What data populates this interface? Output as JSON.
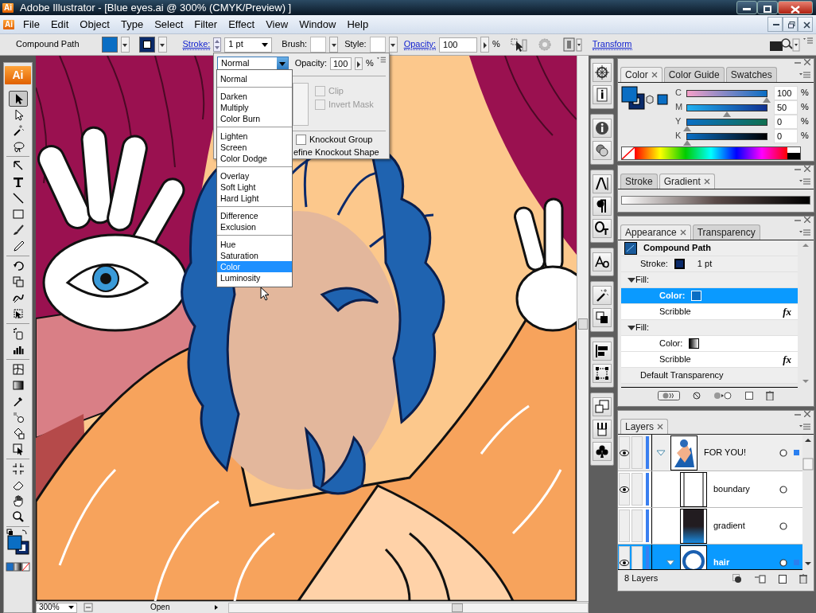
{
  "window": {
    "title": "Adobe Illustrator - [Blue eyes.ai @ 300% (CMYK/Preview) ]",
    "app_icon": "Ai"
  },
  "menu_icon": "Ai",
  "menu": [
    "File",
    "Edit",
    "Object",
    "Type",
    "Select",
    "Filter",
    "Effect",
    "View",
    "Window",
    "Help"
  ],
  "control_bar": {
    "selection": "Compound Path",
    "stroke_label": "Stroke:",
    "stroke_weight": "1 pt",
    "brush_label": "Brush:",
    "style_label": "Style:",
    "opacity_label": "Opacity:",
    "opacity": "100",
    "percent": "%",
    "transform": "Transform"
  },
  "toolbox": {
    "logo": "Ai",
    "groups": [
      [
        {
          "selected": true
        },
        {
          "selected": false
        },
        {
          "selected": false
        },
        {
          "selected": false
        }
      ],
      [
        {
          "selected": false
        },
        {
          "selected": false
        },
        {
          "selected": false
        },
        {
          "selected": false
        },
        {
          "selected": false
        },
        {
          "selected": false
        }
      ],
      [
        {
          "selected": false
        },
        {
          "selected": false
        },
        {
          "selected": false
        },
        {
          "selected": false
        }
      ],
      [
        {
          "selected": false
        },
        {
          "selected": false
        }
      ],
      [
        {
          "selected": false
        },
        {
          "selected": false
        },
        {
          "selected": false
        },
        {
          "selected": false
        },
        {
          "selected": false
        },
        {
          "selected": false
        }
      ],
      [
        {
          "selected": false
        },
        {
          "selected": false
        },
        {
          "selected": false
        },
        {
          "selected": false
        }
      ]
    ]
  },
  "transparency_popup": {
    "blend_mode": "Normal",
    "opacity_label": "Opacity:",
    "opacity": "100",
    "percent": "%",
    "mask_options": [
      {
        "label": "Clip",
        "checked": false,
        "disabled": true
      },
      {
        "label": "Invert Mask",
        "checked": false,
        "disabled": true
      }
    ],
    "knockout_group": {
      "label": "Knockout Group",
      "checked": false
    },
    "define_knockout": "efine Knockout Shape"
  },
  "blend_modes": [
    [
      {
        "label": "Normal",
        "selected": false
      }
    ],
    [
      {
        "label": "Darken",
        "selected": false
      },
      {
        "label": "Multiply",
        "selected": false
      },
      {
        "label": "Color Burn",
        "selected": false
      }
    ],
    [
      {
        "label": "Lighten",
        "selected": false
      },
      {
        "label": "Screen",
        "selected": false
      },
      {
        "label": "Color Dodge",
        "selected": false
      }
    ],
    [
      {
        "label": "Overlay",
        "selected": false
      },
      {
        "label": "Soft Light",
        "selected": false
      },
      {
        "label": "Hard Light",
        "selected": false
      }
    ],
    [
      {
        "label": "Difference",
        "selected": false
      },
      {
        "label": "Exclusion",
        "selected": false
      }
    ],
    [
      {
        "label": "Hue",
        "selected": false
      },
      {
        "label": "Saturation",
        "selected": false
      },
      {
        "label": "Color",
        "selected": true
      },
      {
        "label": "Luminosity",
        "selected": false
      }
    ]
  ],
  "color_panel": {
    "tabs": [
      {
        "label": "Color",
        "selected": true
      },
      {
        "label": "Color Guide",
        "selected": false
      },
      {
        "label": "Swatches",
        "selected": false
      }
    ],
    "sliders": [
      {
        "label": "C",
        "value": "100",
        "level": 1.0,
        "unit": "%"
      },
      {
        "label": "M",
        "value": "50",
        "level": 0.5,
        "unit": "%"
      },
      {
        "label": "Y",
        "value": "0",
        "level": 0.0,
        "unit": "%"
      },
      {
        "label": "K",
        "value": "0",
        "level": 0.0,
        "unit": "%"
      }
    ]
  },
  "gradient_panel": {
    "tabs": [
      {
        "label": "Stroke",
        "selected": false
      },
      {
        "label": "Gradient",
        "selected": true
      }
    ]
  },
  "appearance_panel": {
    "tabs": [
      {
        "label": "Appearance",
        "selected": true
      },
      {
        "label": "Transparency",
        "selected": false
      }
    ],
    "rows": [
      {
        "kind": "header",
        "label": "Compound Path",
        "selected": false
      },
      {
        "kind": "stroke",
        "label": "Stroke:",
        "value": "1 pt",
        "selected": false
      },
      {
        "kind": "fill",
        "label": "Fill:",
        "expanded": true,
        "selected": false,
        "children": [
          {
            "kind": "color",
            "label": "Color:",
            "selected": true
          },
          {
            "kind": "effect",
            "label": "Scribble",
            "badge": "fx",
            "selected": false
          }
        ]
      },
      {
        "kind": "fill",
        "label": "Fill:",
        "expanded": true,
        "selected": false,
        "children": [
          {
            "kind": "gradient",
            "label": "Color:",
            "selected": false
          },
          {
            "kind": "effect",
            "label": "Scribble",
            "badge": "fx",
            "selected": false
          }
        ]
      },
      {
        "kind": "transparency",
        "label": "Default Transparency",
        "selected": false
      }
    ]
  },
  "layers_panel": {
    "tabs": [
      {
        "label": "Layers",
        "selected": true
      }
    ],
    "layers": [
      {
        "name": "FOR YOU!",
        "visible": true,
        "expanded": true,
        "art_selected": true,
        "selected": false,
        "children": [
          {
            "name": "boundary",
            "visible": true,
            "art_selected": false,
            "selected": false
          },
          {
            "name": "gradient",
            "visible": false,
            "art_selected": false,
            "selected": false
          },
          {
            "name": "hair",
            "visible": true,
            "expanded": true,
            "art_selected": true,
            "selected": true
          }
        ]
      }
    ],
    "count": "8 Layers"
  },
  "status_bar": {
    "zoom": "300%",
    "status": "Open"
  }
}
